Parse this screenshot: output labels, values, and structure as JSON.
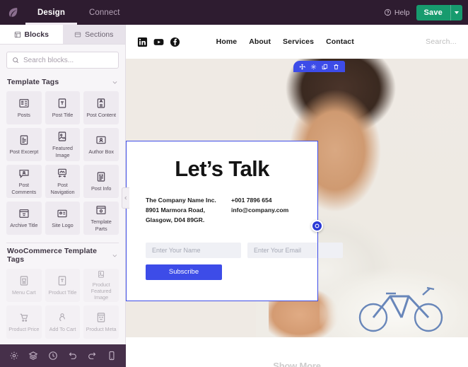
{
  "topbar": {
    "logo_icon": "leaf-logo-icon",
    "tabs": [
      {
        "label": "Design",
        "active": true
      },
      {
        "label": "Connect",
        "active": false
      }
    ],
    "help_label": "Help",
    "help_icon": "question-circle-icon",
    "save_label": "Save",
    "save_dropdown_icon": "chevron-down-icon",
    "colors": {
      "bar_bg": "#2e1c30",
      "save_green": "#179b6e"
    }
  },
  "sidebar": {
    "tabs": [
      {
        "label": "Blocks",
        "icon": "blocks-icon",
        "active": true
      },
      {
        "label": "Sections",
        "icon": "sections-icon",
        "active": false
      }
    ],
    "search": {
      "placeholder": "Search blocks...",
      "value": "",
      "icon": "search-icon"
    },
    "groups": [
      {
        "title": "Template Tags",
        "collapse_icon": "chevron-down-icon",
        "disabled": false,
        "items": [
          {
            "label": "Posts",
            "icon": "posts-icon"
          },
          {
            "label": "Post Title",
            "icon": "post-title-icon"
          },
          {
            "label": "Post Content",
            "icon": "post-content-icon"
          },
          {
            "label": "Post Excerpt",
            "icon": "post-excerpt-icon"
          },
          {
            "label": "Featured Image",
            "icon": "featured-image-icon"
          },
          {
            "label": "Author Box",
            "icon": "author-box-icon"
          },
          {
            "label": "Post Comments",
            "icon": "post-comments-icon"
          },
          {
            "label": "Post Navigation",
            "icon": "post-navigation-icon"
          },
          {
            "label": "Post Info",
            "icon": "post-info-icon"
          },
          {
            "label": "Archive Title",
            "icon": "archive-title-icon"
          },
          {
            "label": "Site Logo",
            "icon": "site-logo-icon"
          },
          {
            "label": "Template Parts",
            "icon": "template-parts-icon"
          }
        ]
      },
      {
        "title": "WooCommerce Template Tags",
        "collapse_icon": "chevron-down-icon",
        "disabled": true,
        "items": [
          {
            "label": "Menu Cart",
            "icon": "menu-cart-icon"
          },
          {
            "label": "Product Title",
            "icon": "product-title-icon"
          },
          {
            "label": "Product Featured Image",
            "icon": "product-featured-image-icon"
          },
          {
            "label": "Product Price",
            "icon": "product-price-icon"
          },
          {
            "label": "Add To Cart",
            "icon": "add-to-cart-icon"
          },
          {
            "label": "Product Meta",
            "icon": "product-meta-icon"
          }
        ]
      }
    ],
    "bottom_tools": [
      {
        "name": "settings-icon",
        "label": "Settings"
      },
      {
        "name": "layers-icon",
        "label": "Layers"
      },
      {
        "name": "history-icon",
        "label": "History"
      },
      {
        "name": "undo-icon",
        "label": "Undo"
      },
      {
        "name": "redo-icon",
        "label": "Redo"
      },
      {
        "name": "responsive-mode-icon",
        "label": "Responsive"
      }
    ],
    "collapse_icon": "chevron-left-icon"
  },
  "preview": {
    "site_nav": {
      "socials": [
        {
          "name": "linkedin-icon",
          "label": "LinkedIn"
        },
        {
          "name": "youtube-icon",
          "label": "YouTube"
        },
        {
          "name": "facebook-icon",
          "label": "Facebook"
        }
      ],
      "links": [
        "Home",
        "About",
        "Services",
        "Contact"
      ],
      "search_label": "Search..."
    },
    "contact_card": {
      "heading": "Let’s Talk",
      "address_lines": [
        "The Company Name Inc.",
        "8901 Marmora Road,",
        "Glasgow, D04 89GR."
      ],
      "contact_lines": [
        "+001 7896 654",
        "info@company.com"
      ],
      "name_placeholder": "Enter Your Name",
      "email_placeholder": "Enter Your Email",
      "subscribe_label": "Subscribe",
      "accent_color": "#3d4ce8"
    },
    "edit_toolbar": [
      {
        "name": "move-handle-icon",
        "label": "Move"
      },
      {
        "name": "settings-gear-icon",
        "label": "Settings"
      },
      {
        "name": "duplicate-icon",
        "label": "Duplicate"
      },
      {
        "name": "delete-icon",
        "label": "Delete"
      }
    ],
    "add_section_icon": "add-section-icon",
    "next_section_partial_text": "Show More"
  }
}
